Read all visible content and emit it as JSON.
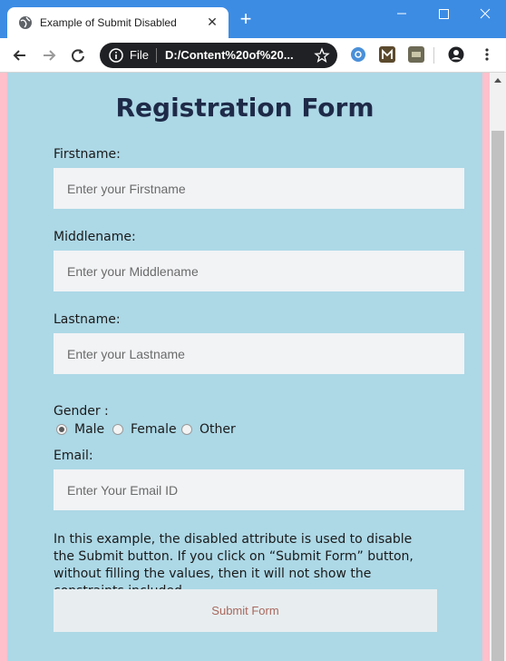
{
  "browser": {
    "tab_title": "Example of Submit Disabled",
    "new_tab_label": "+",
    "omnibox_scheme": "File",
    "omnibox_url": "D:/Content%20of%20...",
    "window_close_glyph": "✕"
  },
  "form": {
    "title": "Registration Form",
    "firstname_label": "Firstname:",
    "firstname_placeholder": "Enter your Firstname",
    "middlename_label": "Middlename:",
    "middlename_placeholder": "Enter your Middlename",
    "lastname_label": "Lastname:",
    "lastname_placeholder": "Enter your Lastname",
    "gender_label": "Gender :",
    "gender_options": [
      "Male",
      "Female",
      "Other"
    ],
    "gender_selected": "Male",
    "email_label": "Email:",
    "email_placeholder": "Enter Your Email ID",
    "note": "In this example, the disabled attribute is used to disable the Submit button. If you click on “Submit Form” button, without filling the values, then it will not show the constraints included.",
    "submit_label": "Submit Form"
  },
  "colors": {
    "page_background": "#add8e6",
    "body_background": "#ffc0cb",
    "title_color": "#1e2a48",
    "titlebar": "#3c8ce4",
    "submit_text": "#a9685e"
  }
}
